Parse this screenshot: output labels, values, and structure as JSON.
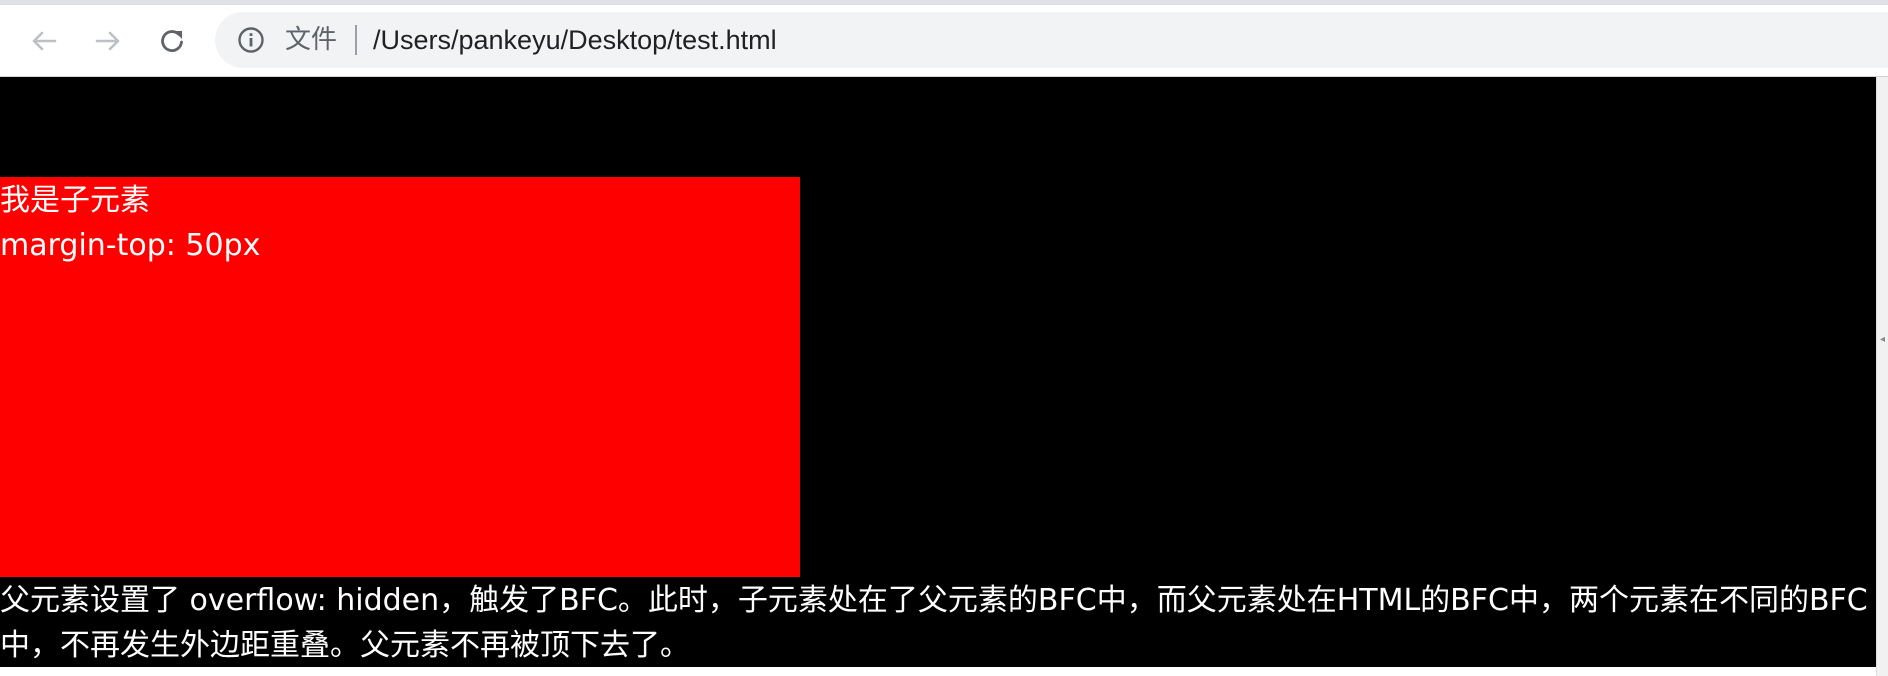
{
  "browser": {
    "scheme_label": "文件",
    "url": "/Users/pankeyu/Desktop/test.html",
    "icons": {
      "back": "arrow-left-icon",
      "forward": "arrow-right-icon",
      "reload": "reload-icon",
      "site_info": "info-circle-icon"
    }
  },
  "page": {
    "child": {
      "line1": "我是子元素",
      "line2": "margin-top: 50px",
      "color": "#ff0000"
    },
    "parent_color": "#000000",
    "note": "父元素设置了 overflow: hidden，触发了BFC。此时，子元素处在了父元素的BFC中，而父元素处在HTML的BFC中，两个元素在不同的BFC中，不再发生外边距重叠。父元素不再被顶下去了。"
  }
}
